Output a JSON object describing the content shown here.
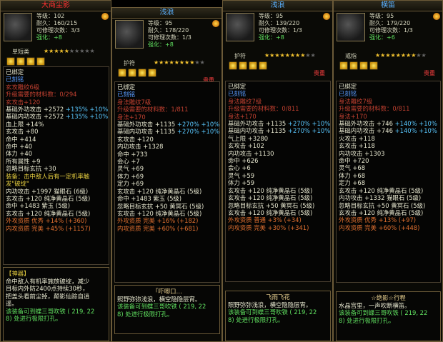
{
  "panels": [
    {
      "title": "大商尘影",
      "title_color": "#ff3030",
      "level": "等级：102",
      "durability": "耐久：160/215",
      "upgrade": "可修理次数：3/3",
      "enhance": "强化：+8",
      "type": "单短类",
      "stars": 5,
      "gems": [
        "yellow",
        "yellow",
        "yellow",
        "yellow"
      ],
      "rarity": "贵重",
      "lines": [
        {
          "t": "已绑定",
          "c": "c-white"
        },
        {
          "t": "已刻铭",
          "c": "c-blue"
        },
        {
          "t": "玄攻雕纹6级",
          "c": "c-dred"
        },
        {
          "t": "升级需要的材料数：0/294",
          "c": "c-dred"
        },
        {
          "t": "玄攻击+120",
          "c": "c-dred"
        },
        {
          "t": "基础外功攻击 +2572",
          "b": "+135% +10%",
          "c": "c-white"
        },
        {
          "t": "基础内功攻击 +2572",
          "b": "+135% +10%",
          "c": "c-white"
        },
        {
          "t": "血上限 +14%",
          "c": "c-white"
        },
        {
          "t": "玄攻击 +80",
          "c": "c-white"
        },
        {
          "t": "命中 +414",
          "c": "c-white"
        },
        {
          "t": "命中 +40",
          "c": "c-white"
        },
        {
          "t": "体力 +40",
          "c": "c-white"
        },
        {
          "t": "所有属性 +9",
          "c": "c-white"
        },
        {
          "t": "忽略目标玄抗 +30",
          "c": "c-white"
        },
        {
          "t": "装备：击中敌人后有一定机率触",
          "c": "c-yellow"
        },
        {
          "t": "发\"破绽\"",
          "c": "c-yellow"
        },
        {
          "t": "内功攻击 +1997 猫眼石 (6级)",
          "c": "c-white"
        },
        {
          "t": "玄攻击 +120 纯净黄晶石 (5级)",
          "c": "c-white"
        },
        {
          "t": "命中 +1483 紫玉 (5级)",
          "c": "c-white"
        },
        {
          "t": "玄攻击 +120 纯净黄晶石 (5级)",
          "c": "c-white"
        },
        {
          "t": "外攻资质 优秀 +14% (+360)",
          "c": "c-orange"
        },
        {
          "t": "内攻资质 完美 +45% (+1157)",
          "c": "c-orange"
        }
      ],
      "footer_title": "【神器】",
      "footer_lines": [
        {
          "t": "命中敌人有机率施放破绽，减少",
          "c": "c-white"
        },
        {
          "t": "目标内外防2400点持续30秒，",
          "c": "c-white"
        },
        {
          "t": "把盖头看前尘掉，颠影仙踪自逍",
          "c": "c-white"
        },
        {
          "t": "遥。",
          "c": "c-white"
        },
        {
          "t": "该装备可到蝶三哥吹铁 ( 219, 22",
          "c": "c-green"
        },
        {
          "t": "8) 处进行极限打孔。",
          "c": "c-green"
        }
      ]
    },
    {
      "title": "浅浪",
      "title_color": "#5ab0ff",
      "level": "等级：95",
      "durability": "耐久：178/220",
      "upgrade": "可修理次数：1/3",
      "enhance": "强化：+8",
      "type": "护符",
      "stars": 8,
      "gems": [
        "yellow",
        "yellow",
        "yellow",
        "yellow"
      ],
      "rarity": "贵重",
      "lines": [
        {
          "t": "已绑定",
          "c": "c-white"
        },
        {
          "t": "已刻铭",
          "c": "c-blue"
        },
        {
          "t": "身法雕纹7级",
          "c": "c-dred"
        },
        {
          "t": "升级需要的材料数：1/811",
          "c": "c-dred"
        },
        {
          "t": "身法+170",
          "c": "c-dred"
        },
        {
          "t": "基础外功攻击 +1135",
          "b": "+270% +10%",
          "c": "c-white"
        },
        {
          "t": "基础内功攻击 +1135",
          "b": "+270% +10%",
          "c": "c-white"
        },
        {
          "t": "玄攻击 +120",
          "c": "c-white"
        },
        {
          "t": "内功攻击 +1328",
          "c": "c-white"
        },
        {
          "t": "命中 +733",
          "c": "c-white"
        },
        {
          "t": "会心 +7",
          "c": "c-white"
        },
        {
          "t": "灵气 +69",
          "c": "c-white"
        },
        {
          "t": "体力 +69",
          "c": "c-white"
        },
        {
          "t": "定力 +69",
          "c": "c-white"
        },
        {
          "t": "玄攻击 +120 纯净黄晶石 (5级)",
          "c": "c-white"
        },
        {
          "t": "命中 +1483 紫玉 (5级)",
          "c": "c-white"
        },
        {
          "t": "忽略目标玄抗 +50 黄冥石 (5级)",
          "c": "c-white"
        },
        {
          "t": "玄攻击 +120 纯净黄晶石 (5级)",
          "c": "c-white"
        },
        {
          "t": "外攻资质 完美 +16% (+182)",
          "c": "c-orange"
        },
        {
          "t": "内攻资质 完美 +60% (+681)",
          "c": "c-orange"
        }
      ],
      "footer_title": "「吓唧口…",
      "footer_lines": [
        {
          "t": "照野弥弥浅浪，横空隐隐层宵。",
          "c": "c-white"
        },
        {
          "t": "该装备可到蝶三哥吹铁 ( 219, 22",
          "c": "c-green"
        },
        {
          "t": "8) 处进行极限打孔。",
          "c": "c-green"
        }
      ]
    },
    {
      "title": "浅浪",
      "title_color": "#5ab0ff",
      "level": "等级：95",
      "durability": "耐久：139/220",
      "upgrade": "可修理次数：1/3",
      "enhance": "强化：+8",
      "type": "护符",
      "stars": 8,
      "gems": [
        "yellow",
        "yellow",
        "yellow",
        "yellow"
      ],
      "rarity": "贵重",
      "lines": [
        {
          "t": "已绑定",
          "c": "c-white"
        },
        {
          "t": "已刻铭",
          "c": "c-blue"
        },
        {
          "t": "身法雕纹7级",
          "c": "c-dred"
        },
        {
          "t": "升级需要的材料数：0/811",
          "c": "c-dred"
        },
        {
          "t": "身法+170",
          "c": "c-dred"
        },
        {
          "t": "基础外功攻击 +1135",
          "b": "+270% +10%",
          "c": "c-white"
        },
        {
          "t": "基础内功攻击 +1135",
          "b": "+270% +10%",
          "c": "c-white"
        },
        {
          "t": "气上限 +3280",
          "c": "c-white"
        },
        {
          "t": "玄攻击 +102",
          "c": "c-white"
        },
        {
          "t": "内功攻击 +1130",
          "c": "c-white"
        },
        {
          "t": "命中 +626",
          "c": "c-white"
        },
        {
          "t": "会心 +6",
          "c": "c-white"
        },
        {
          "t": "灵气 +59",
          "c": "c-white"
        },
        {
          "t": "体力 +59",
          "c": "c-white"
        },
        {
          "t": "玄攻击 +120 纯净黄晶石 (5级)",
          "c": "c-white"
        },
        {
          "t": "玄攻击 +120 纯净黄晶石 (5级)",
          "c": "c-white"
        },
        {
          "t": "忽略目标玄抗 +50 黄冥石 (5级)",
          "c": "c-white"
        },
        {
          "t": "玄攻击 +120 纯净黄晶石 (5级)",
          "c": "c-white"
        },
        {
          "t": "外攻资质 普通 +3% (+34)",
          "c": "c-orange"
        },
        {
          "t": "内攻资质 完美 +30% (+341)",
          "c": "c-orange"
        }
      ],
      "footer_title": "飞雨飞花",
      "footer_lines": [
        {
          "t": "照野弥弥浅浪，横空隐隐层宵。",
          "c": "c-white"
        },
        {
          "t": "该装备可到蝶三哥吹铁 ( 219, 22",
          "c": "c-green"
        },
        {
          "t": "8) 处进行极限打孔。",
          "c": "c-green"
        }
      ]
    },
    {
      "title": "横笛",
      "title_color": "#5ab0ff",
      "level": "等级：95",
      "durability": "耐久：179/220",
      "upgrade": "可修理次数：1/3",
      "enhance": "强化：+6",
      "type": "戒指",
      "stars": 8,
      "gems": [
        "yellow",
        "yellow",
        "yellow",
        "yellow"
      ],
      "rarity": "贵重",
      "lines": [
        {
          "t": "已绑定",
          "c": "c-white"
        },
        {
          "t": "已刻铭",
          "c": "c-blue"
        },
        {
          "t": "身法雕纹7级",
          "c": "c-dred"
        },
        {
          "t": "升级需要的材料数：0/811",
          "c": "c-dred"
        },
        {
          "t": "身法+170",
          "c": "c-dred"
        },
        {
          "t": "基础外功攻击 +746",
          "b": "+140% +10%",
          "c": "c-white"
        },
        {
          "t": "基础内功攻击 +746",
          "b": "+140% +10%",
          "c": "c-white"
        },
        {
          "t": "火攻击 +118",
          "c": "c-white"
        },
        {
          "t": "玄攻击 +118",
          "c": "c-white"
        },
        {
          "t": "内功攻击 +1303",
          "c": "c-white"
        },
        {
          "t": "命中 +720",
          "c": "c-white"
        },
        {
          "t": "灵气 +68",
          "c": "c-white"
        },
        {
          "t": "体力 +68",
          "c": "c-white"
        },
        {
          "t": "定力 +68",
          "c": "c-white"
        },
        {
          "t": "玄攻击 +120 纯净黄晶石 (5级)",
          "c": "c-white"
        },
        {
          "t": "内功攻击 +1332 猫眼石 (5级)",
          "c": "c-white"
        },
        {
          "t": "忽略目标玄抗 +50 黄冥石 (5级)",
          "c": "c-white"
        },
        {
          "t": "玄攻击 +120 纯净黄晶石 (5级)",
          "c": "c-white"
        },
        {
          "t": "外攻资质 优秀 +13% (+97)",
          "c": "c-orange"
        },
        {
          "t": "内攻资质 完美 +60% (+448)",
          "c": "c-orange"
        }
      ],
      "footer_title": "☆绝影☆行程",
      "footer_lines": [
        {
          "t": "水晶宫里，一声吹断横笛。",
          "c": "c-white"
        },
        {
          "t": "该装备可到蝶三哥吹铁 ( 219, 22",
          "c": "c-green"
        },
        {
          "t": "8) 处进行极限打孔。",
          "c": "c-green"
        }
      ]
    }
  ]
}
